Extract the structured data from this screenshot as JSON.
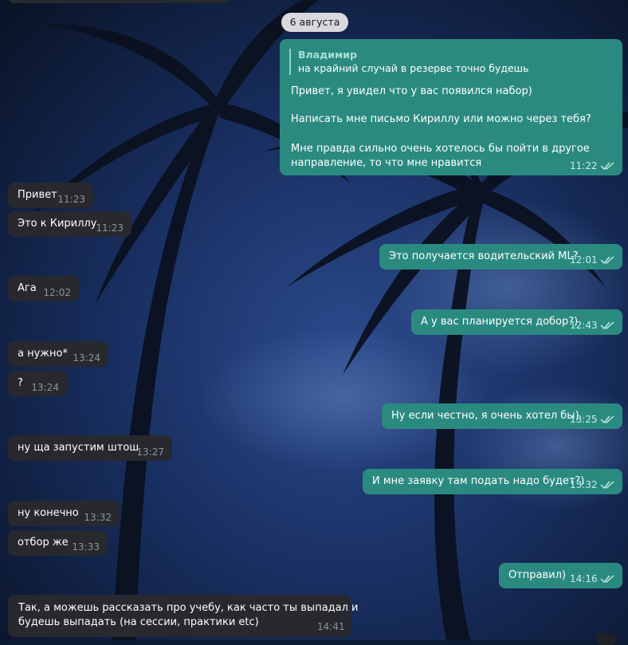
{
  "date_label": "6 августа",
  "first_message": {
    "reply_author": "Владимир",
    "reply_text": "на крайний случай в резерве точно будешь",
    "line1": "Привет, я увидел что у вас появился набор)",
    "line2": "Написать мне письмо Кириллу или можно через тебя?",
    "line3": "Мне правда сильно очень хотелось бы пойти в другое",
    "line4": "направление, то что мне нравится",
    "time": "11:22"
  },
  "messages": [
    {
      "dir": "in",
      "text": "Привет",
      "time": "11:23"
    },
    {
      "dir": "in",
      "text": "Это к Кириллу",
      "time": "11:23"
    },
    {
      "dir": "out",
      "text": "Это получается водительский ML?",
      "time": "12:01"
    },
    {
      "dir": "in",
      "text": "Ага",
      "time": "12:02"
    },
    {
      "dir": "out",
      "text": "А у вас планируется добор?)",
      "time": "12:43"
    },
    {
      "dir": "in",
      "text": "а нужно*",
      "time": "13:24"
    },
    {
      "dir": "in",
      "text": "?",
      "time": "13:24"
    },
    {
      "dir": "out",
      "text": "Ну если честно, я очень хотел бы)",
      "time": "13:25"
    },
    {
      "dir": "in",
      "text": "ну ща запустим штош",
      "time": "13:27"
    },
    {
      "dir": "out",
      "text": "И мне заявку там подать надо будет?)",
      "time": "13:32"
    },
    {
      "dir": "in",
      "text": "ну конечно",
      "time": "13:32"
    },
    {
      "dir": "in",
      "text": "отбор же",
      "time": "13:33"
    },
    {
      "dir": "out",
      "text": "Отправил)",
      "time": "14:16"
    }
  ],
  "last_message": {
    "line1": "Так, а можешь рассказать про учебу, как часто ты выпадал и",
    "line2": "будешь выпадать (на сессии, практики etc)",
    "time": "14:41"
  },
  "colors": {
    "incoming_bubble": "#27292f",
    "outgoing_bubble": "#2b8a80",
    "wallpaper": "#0d1a33"
  }
}
